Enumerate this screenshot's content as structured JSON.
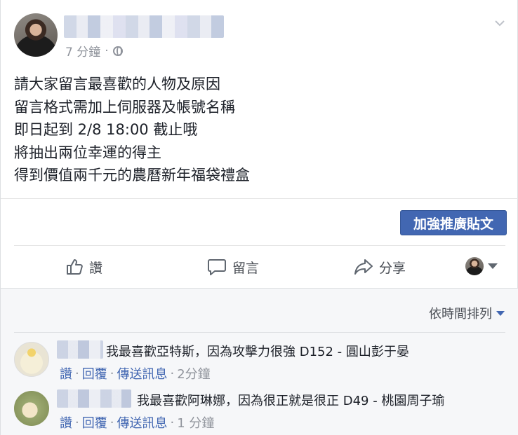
{
  "post": {
    "meta_time": "7 分鐘",
    "meta_separator": "·",
    "lines": [
      "請大家留言最喜歡的人物及原因",
      "留言格式需加上伺服器及帳號名稱",
      "即日起到 2/8 18:00 截止哦",
      "將抽出兩位幸運的得主",
      "得到價值兩千元的農曆新年福袋禮盒"
    ],
    "boost_label": "加強推廣貼文"
  },
  "actions": {
    "like_label": "讚",
    "comment_label": "留言",
    "share_label": "分享"
  },
  "comments": {
    "sort_label": "依時間排列",
    "items": [
      {
        "text": "我最喜歡亞特斯，因為攻擊力很強 D152 - 圓山彭于晏",
        "like": "讚",
        "reply": "回覆",
        "message": "傳送訊息",
        "time": "2分鐘",
        "sep": "·"
      },
      {
        "text": "我最喜歡阿琳娜，因為很正就是很正 D49 - 桃園周子瑜",
        "like": "讚",
        "reply": "回覆",
        "message": "傳送訊息",
        "time": "1 分鐘",
        "sep": "·"
      }
    ]
  },
  "colors": {
    "brand_blue": "#4267b2",
    "meta_gray": "#90949c",
    "comments_bg": "#f6f7f9"
  }
}
